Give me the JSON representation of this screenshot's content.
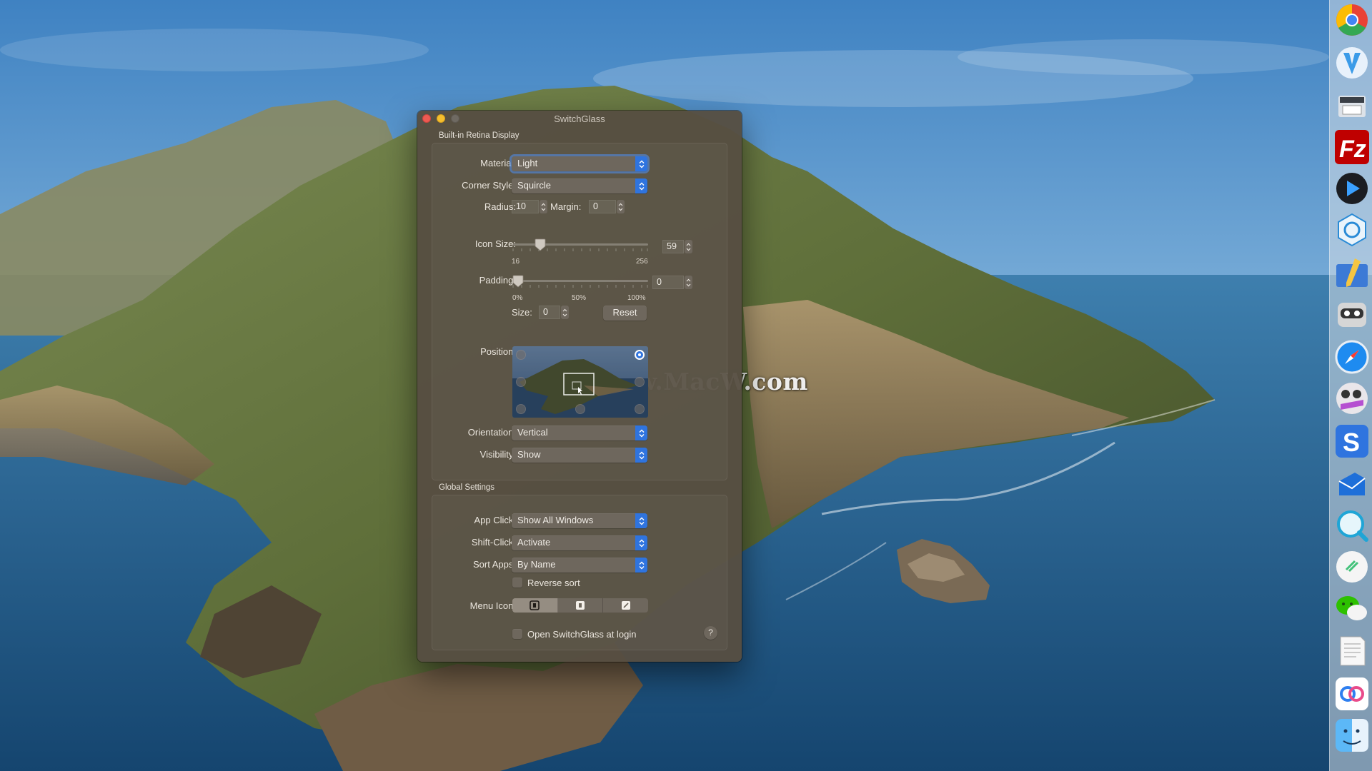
{
  "window": {
    "title": "SwitchGlass"
  },
  "display_section": {
    "title": "Built-in Retina Display",
    "material": {
      "label": "Material:",
      "value": "Light"
    },
    "corner_style": {
      "label": "Corner Style:",
      "value": "Squircle"
    },
    "radius": {
      "label": "Radius:",
      "value": "10"
    },
    "margin": {
      "label": "Margin:",
      "value": "0"
    },
    "icon_size": {
      "label": "Icon Size:",
      "value": "59",
      "min_label": "16",
      "max_label": "256",
      "level": 0.18
    },
    "padding": {
      "label": "Padding:",
      "value": "0",
      "min_label": "0%",
      "mid_label": "50%",
      "max_label": "100%",
      "level": 0.0
    },
    "size": {
      "label": "Size:",
      "value": "0"
    },
    "reset_label": "Reset",
    "position": {
      "label": "Position:",
      "selected": "top-right"
    },
    "orientation": {
      "label": "Orientation:",
      "value": "Vertical"
    },
    "visibility": {
      "label": "Visibility:",
      "value": "Show"
    }
  },
  "global_section": {
    "title": "Global Settings",
    "app_click": {
      "label": "App Click:",
      "value": "Show All Windows"
    },
    "shift_click": {
      "label": "Shift-Click:",
      "value": "Activate"
    },
    "sort_apps": {
      "label": "Sort Apps:",
      "value": "By Name"
    },
    "reverse_sort": {
      "label": "Reverse sort",
      "checked": false
    },
    "menu_icon": {
      "label": "Menu Icon:",
      "options": [
        "app-switcher-icon",
        "app-switcher-filled-icon",
        "pencil-square-icon"
      ],
      "selected_index": 0
    },
    "open_at_login": {
      "label": "Open SwitchGlass at login",
      "checked": false
    },
    "help_label": "?"
  },
  "watermark": "www.MacW.com",
  "dock": {
    "items": [
      "chrome-icon",
      "vectornator-icon",
      "scanner-icon",
      "filezilla-icon",
      "infuse-icon",
      "sync-icon",
      "pencil-app-icon",
      "robot-app-icon",
      "safari-icon",
      "photo-booth-icon",
      "simplenote-icon",
      "vpn-icon",
      "quicklook-icon",
      "notes-check-icon",
      "wechat-icon",
      "textedit-icon",
      "baidu-netdisk-icon",
      "finder-icon"
    ]
  },
  "colors": {
    "accent": "#2f74df",
    "window_bg": "#564e42",
    "control_bg": "#6e675d"
  }
}
